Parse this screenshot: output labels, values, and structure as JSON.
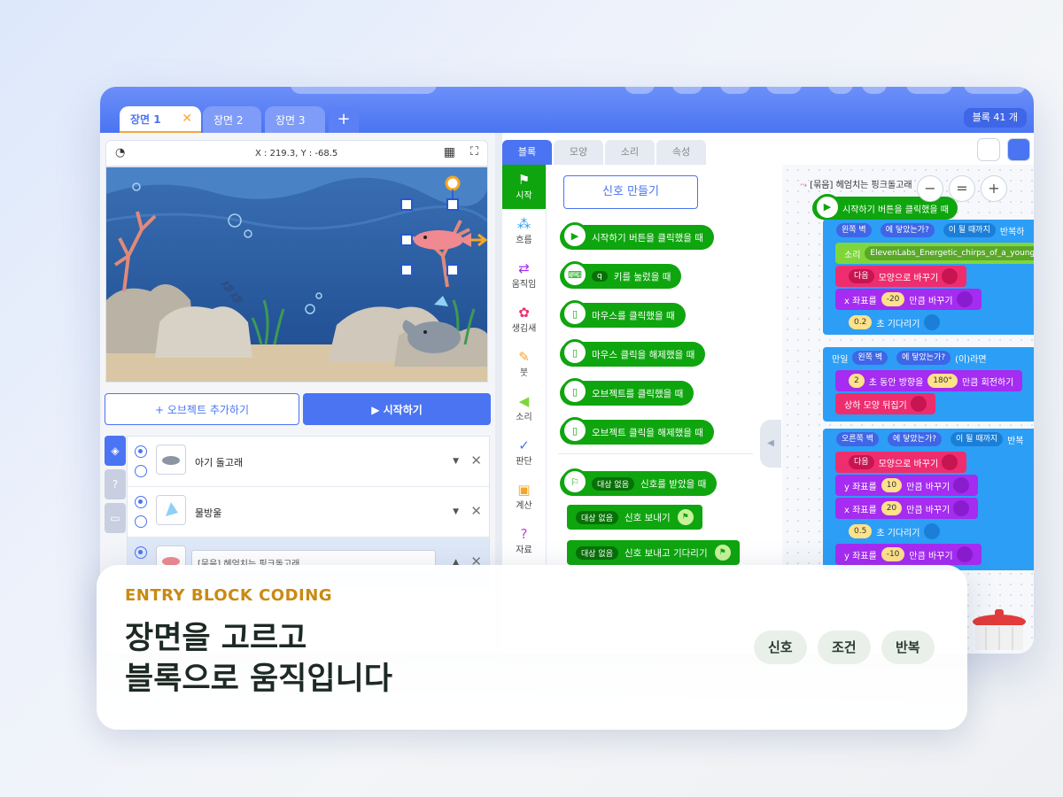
{
  "scene_tabs": [
    {
      "label": "장면 1",
      "active": true
    },
    {
      "label": "장면 2",
      "active": false
    },
    {
      "label": "장면 3",
      "active": false
    }
  ],
  "add_tab": "+",
  "block_count": "블록 41 개",
  "stage": {
    "coords": "X : 219.3, Y : -68.5"
  },
  "buttons": {
    "add_object": "+ 오브젝트 추가하기",
    "start": "▶ 시작하기"
  },
  "objects": [
    {
      "name": "아기 돌고래",
      "selected": false
    },
    {
      "name": "물방울",
      "selected": false
    },
    {
      "name": "[묶음] 헤엄치는 핑크돌고래",
      "selected": true
    }
  ],
  "palette_tabs": [
    "블록",
    "모양",
    "소리",
    "속성"
  ],
  "categories": [
    {
      "label": "시작",
      "icon": "flag-icon",
      "active": true
    },
    {
      "label": "흐름",
      "icon": "flow-icon"
    },
    {
      "label": "움직임",
      "icon": "move-arrows-icon"
    },
    {
      "label": "생김새",
      "icon": "looks-icon"
    },
    {
      "label": "붓",
      "icon": "brush-icon"
    },
    {
      "label": "소리",
      "icon": "speaker-icon"
    },
    {
      "label": "판단",
      "icon": "check-icon"
    },
    {
      "label": "계산",
      "icon": "calc-icon"
    },
    {
      "label": "자료",
      "icon": "question-icon"
    }
  ],
  "palette": {
    "make_signal": "신호 만들기",
    "hat_blocks": [
      "시작하기 버튼을 클릭했을 때",
      "키를 눌렀을 때",
      "마우스를 클릭했을 때",
      "마우스 클릭을 해제했을 때",
      "오브젝트를 클릭했을 때",
      "오브젝트 클릭을 해제했을 때",
      "신호를 받았을 때"
    ],
    "key_value": "q",
    "signal_target": "대상 없음",
    "send_blocks": [
      "신호 보내기",
      "신호 보내고 기다리기"
    ]
  },
  "script": {
    "caption": "[묶음] 헤엄치는 핑크돌고래",
    "start": "시작하기 버튼을 클릭했을 때",
    "repeat1": {
      "target": "왼쪽 벽",
      "cond": "에 닿았는가?",
      "mode": "이 될 때까지",
      "label": "반복하"
    },
    "sound": {
      "label": "소리",
      "value": "ElevenLabs_Energetic_chirps_of_a_young_"
    },
    "next_shape1": {
      "value": "다음",
      "text": "모양으로 바꾸기"
    },
    "x_change1": {
      "pre": "x 좌표를",
      "value": "-20",
      "post": "만큼 바꾸기"
    },
    "wait1": {
      "value": "0.2",
      "text": "초 기다리기"
    },
    "if": {
      "pre": "만일",
      "target": "왼쪽 벽",
      "cond": "에 닿았는가?",
      "post": "(이)라면"
    },
    "rotate": {
      "seconds": "2",
      "pre": "초 동안 방향을",
      "angle": "180°",
      "post": "만큼 회전하기"
    },
    "flip": "상하 모양 뒤집기",
    "repeat2": {
      "target": "오른쪽 벽",
      "cond": "에 닿았는가?",
      "mode": "이 될 때까지",
      "label": "반복"
    },
    "next_shape2": {
      "value": "다음",
      "text": "모양으로 바꾸기"
    },
    "y_change1": {
      "pre": "y 좌표를",
      "value": "10",
      "post": "만큼 바꾸기"
    },
    "x_change2": {
      "pre": "x 좌표를",
      "value": "20",
      "post": "만큼 바꾸기"
    },
    "wait2": {
      "value": "0.5",
      "text": "초 기다리기"
    },
    "y_change2": {
      "pre": "y 좌표를",
      "value": "-10",
      "post": "만큼 바꾸기"
    }
  },
  "zoom": [
    "−",
    "=",
    "+"
  ],
  "card": {
    "kicker": "ENTRY BLOCK CODING",
    "headline_line1": "장면을 고르고",
    "headline_line2": "블록으로 움직입니다",
    "tags": [
      "신호",
      "조건",
      "반복"
    ]
  },
  "colors": {
    "primary": "#4a74f2",
    "start_green": "#0fa50f",
    "flow_blue": "#2c9ef5",
    "move_purple": "#a52cf0",
    "looks_pink": "#ee2d6f",
    "sound_green": "#7fd63b",
    "kicker_gold": "#c98a12"
  }
}
